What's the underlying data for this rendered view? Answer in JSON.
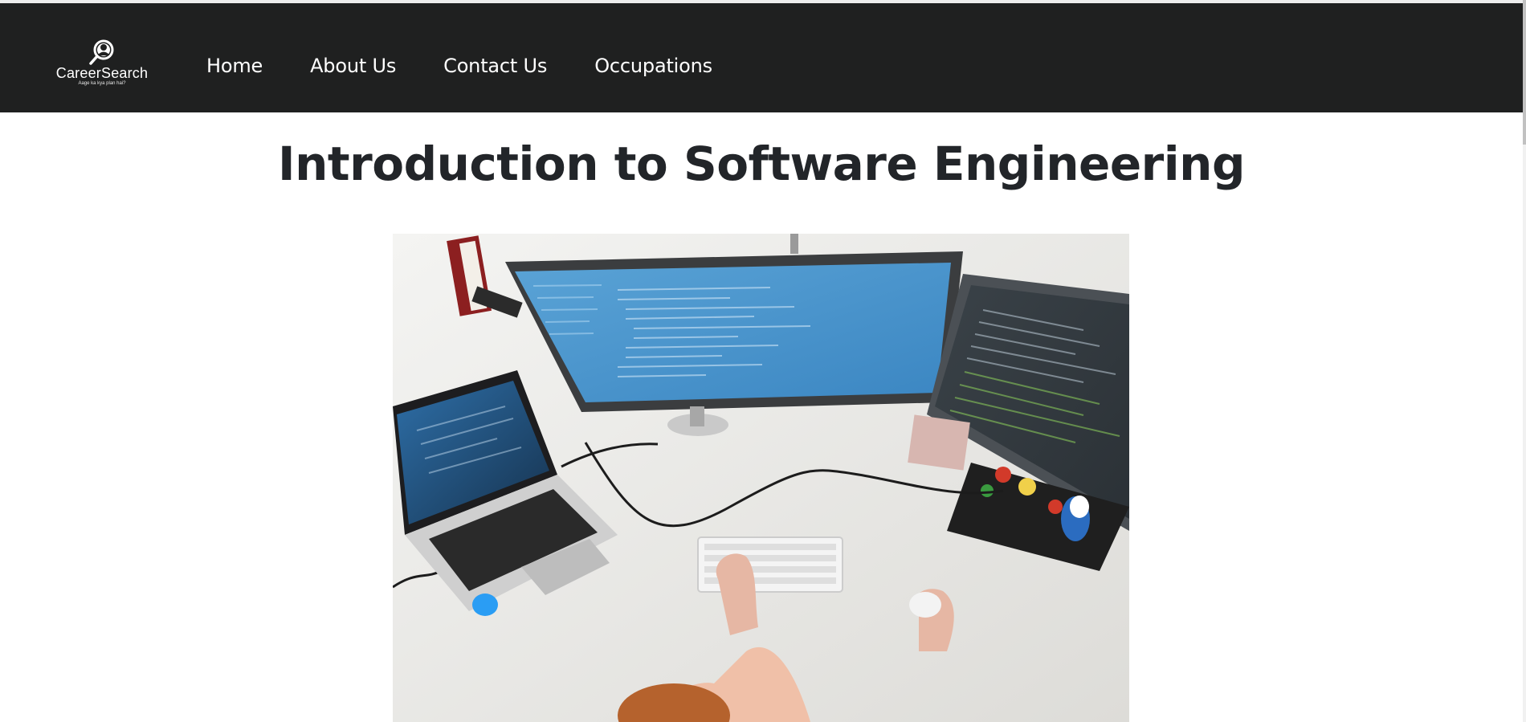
{
  "brand": {
    "name": "CareerSearch",
    "tagline": "Aage ka kya plan hai?"
  },
  "nav": {
    "items": [
      {
        "label": "Home"
      },
      {
        "label": "About Us"
      },
      {
        "label": "Contact Us"
      },
      {
        "label": "Occupations"
      }
    ]
  },
  "main": {
    "title": "Introduction to Software Engineering"
  },
  "colors": {
    "navbar_bg": "#1f2020",
    "nav_text": "#ffffff",
    "title_text": "#222529",
    "page_bg": "#ffffff"
  },
  "icons": {
    "logo": "magnifier-avatar-icon"
  }
}
